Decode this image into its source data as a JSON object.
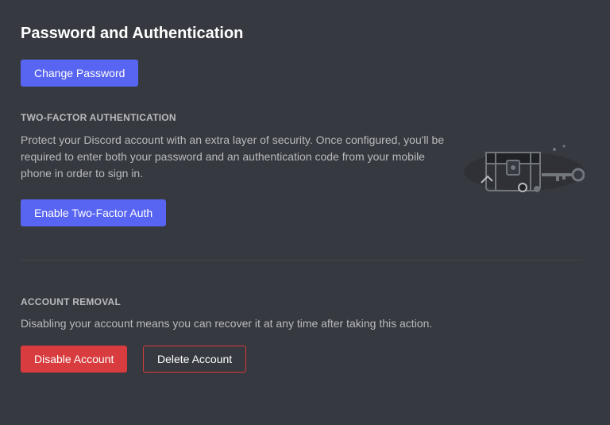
{
  "header": {
    "title": "Password and Authentication"
  },
  "password": {
    "change_label": "Change Password"
  },
  "two_factor": {
    "heading": "Two-Factor Authentication",
    "description": "Protect your Discord account with an extra layer of security. Once configured, you'll be required to enter both your password and an authentication code from your mobile phone in order to sign in.",
    "enable_label": "Enable Two-Factor Auth",
    "illustration_icon": "chest-key-icon"
  },
  "removal": {
    "heading": "Account Removal",
    "description": "Disabling your account means you can recover it at any time after taking this action.",
    "disable_label": "Disable Account",
    "delete_label": "Delete Account"
  },
  "colors": {
    "background": "#36393f",
    "brand": "#5865f2",
    "danger": "#d83c3e",
    "header_text": "#ffffff",
    "muted_text": "#b9bbbe"
  }
}
